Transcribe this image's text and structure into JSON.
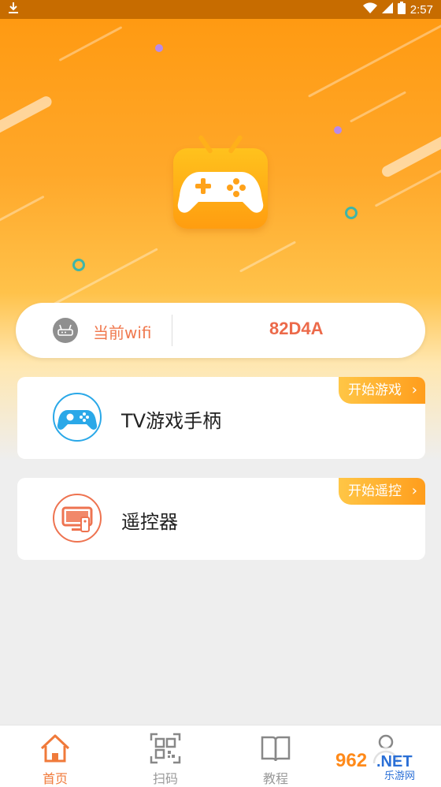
{
  "status_bar": {
    "time": "2:57"
  },
  "wifi": {
    "label": "当前wifi",
    "value": "82D4A"
  },
  "cards": [
    {
      "title": "TV游戏手柄",
      "action": "开始游戏"
    },
    {
      "title": "遥控器",
      "action": "开始遥控"
    }
  ],
  "nav": [
    {
      "label": "首页",
      "icon": "home-icon",
      "active": true
    },
    {
      "label": "扫码",
      "icon": "qr-code-icon",
      "active": false
    },
    {
      "label": "教程",
      "icon": "book-icon",
      "active": false
    },
    {
      "label": "",
      "icon": "user-icon",
      "active": false
    }
  ],
  "watermark": {
    "text": "962.NET",
    "subtext": "乐游网"
  },
  "colors": {
    "accent": "#ff9a12",
    "wifi_value": "#ec6a4a",
    "gamepad_icon": "#2aa8e8",
    "remote_icon": "#ee7350",
    "nav_active": "#f07a3a",
    "nav_inactive": "#999999"
  }
}
